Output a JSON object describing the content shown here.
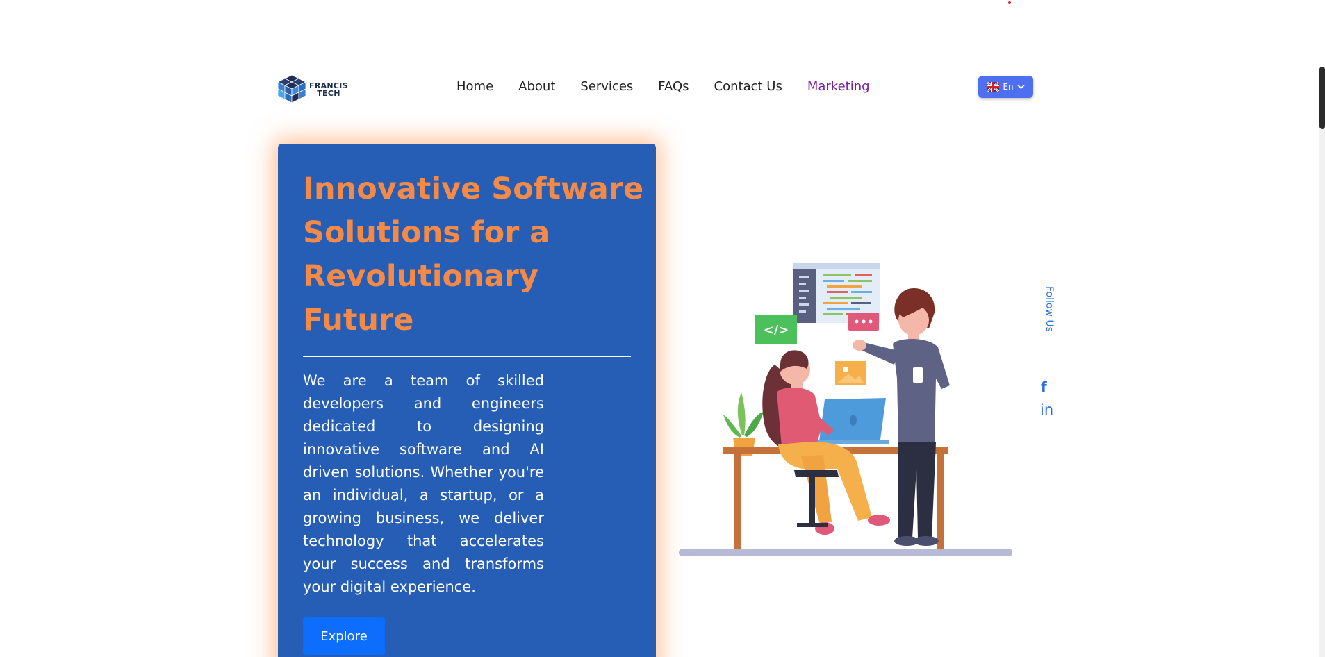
{
  "brand": {
    "logo_line1": "FRANCIS",
    "logo_line2": "TECH"
  },
  "nav": {
    "items": [
      {
        "label": "Home",
        "active": false
      },
      {
        "label": "About",
        "active": false
      },
      {
        "label": "Services",
        "active": false
      },
      {
        "label": "FAQs",
        "active": false
      },
      {
        "label": "Contact Us",
        "active": false
      },
      {
        "label": "Marketing",
        "active": true
      }
    ]
  },
  "language": {
    "selected": "En",
    "flag": "uk-flag-icon"
  },
  "hero": {
    "title": "Innovative Software Solutions for a Revolutionary Future",
    "description": "We are a team of skilled developers and engineers dedicated to designing innovative software and AI driven solutions. Whether you're an individual, a startup, or a growing business, we deliver technology that accelerates your success and transforms your digital experience.",
    "cta_label": "Explore"
  },
  "social": {
    "follow_label": "Follow Us",
    "facebook_glyph": "f",
    "linkedin_glyph": "in"
  },
  "colors": {
    "hero_bg": "#275eb5",
    "hero_title": "#f58a46",
    "nav_active": "#7b1fa2",
    "button": "#0d6efd",
    "lang_button": "#4e6ff0",
    "social": "#2a6fdb"
  }
}
